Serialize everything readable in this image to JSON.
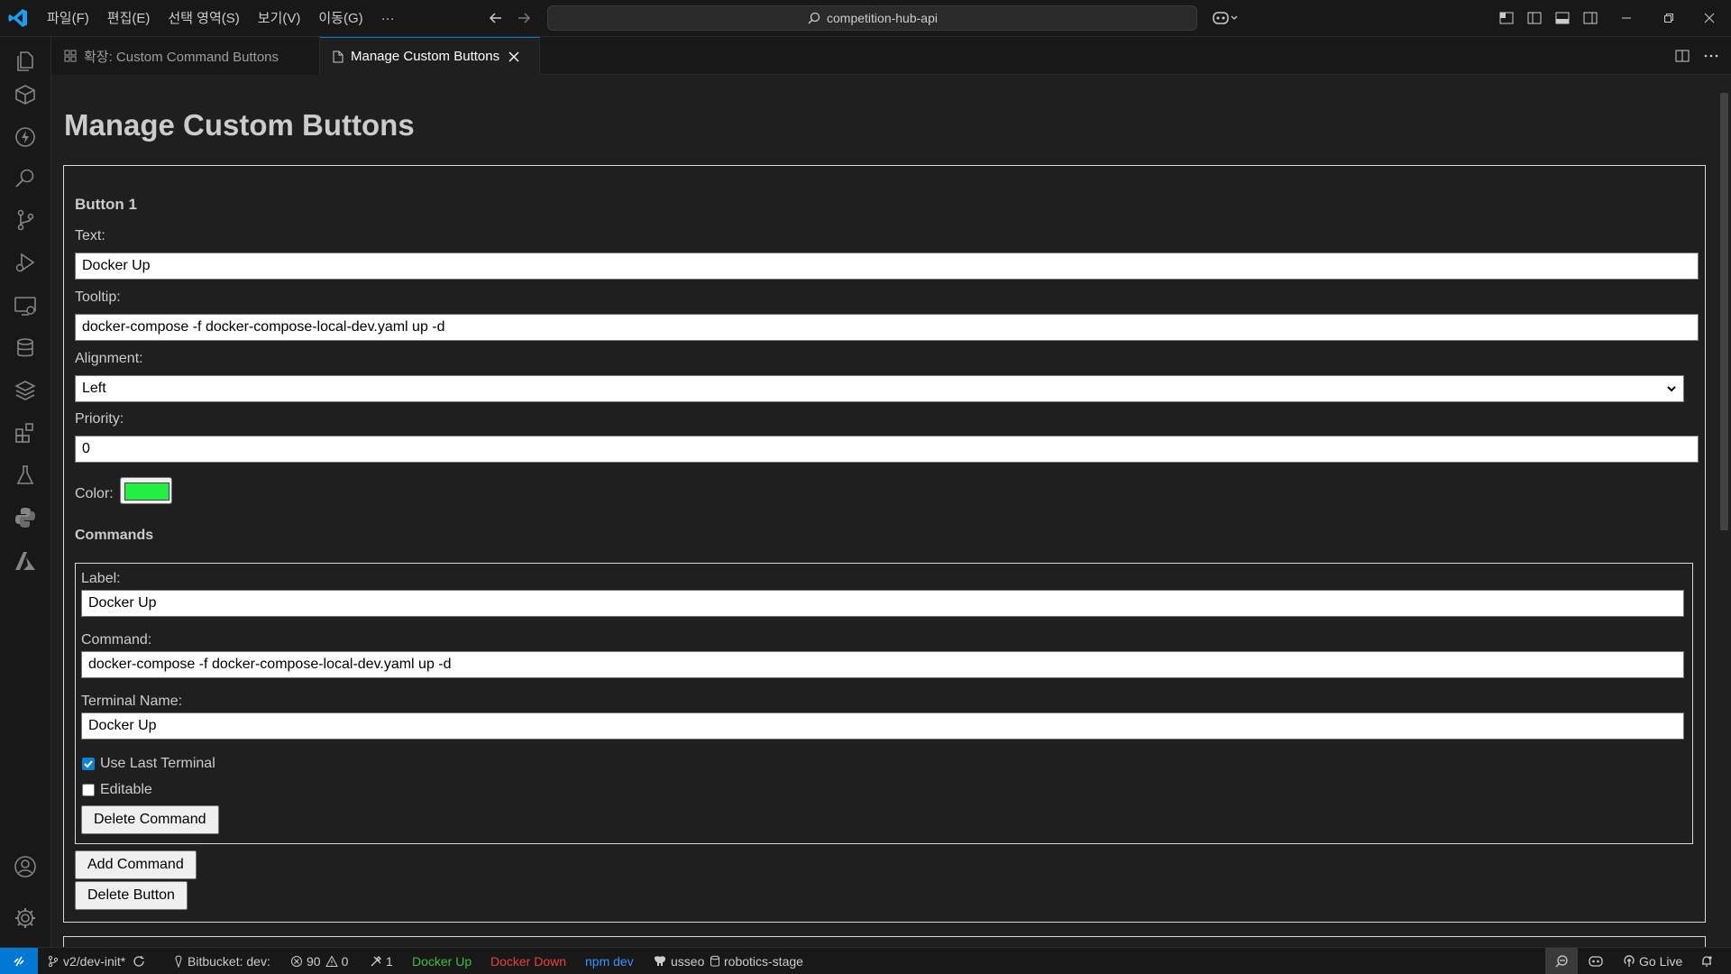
{
  "titlebar": {
    "menus": [
      "파일(F)",
      "편집(E)",
      "선택 영역(S)",
      "보기(V)",
      "이동(G)",
      "···"
    ],
    "search_text": "competition-hub-api"
  },
  "tabs": [
    {
      "label": "확장: Custom Command Buttons",
      "active": false,
      "icon": "extensions-icon"
    },
    {
      "label": "Manage Custom Buttons",
      "active": true,
      "icon": "file-icon"
    }
  ],
  "page": {
    "title": "Manage Custom Buttons",
    "button": {
      "heading": "Button 1",
      "text_label": "Text:",
      "text_value": "Docker Up",
      "tooltip_label": "Tooltip:",
      "tooltip_value": "docker-compose -f docker-compose-local-dev.yaml up -d",
      "alignment_label": "Alignment:",
      "alignment_value": "Left",
      "priority_label": "Priority:",
      "priority_value": "0",
      "color_label": "Color:",
      "color_value": "#22ee44",
      "commands_heading": "Commands",
      "command": {
        "label_label": "Label:",
        "label_value": "Docker Up",
        "command_label": "Command:",
        "command_value": "docker-compose -f docker-compose-local-dev.yaml up -d",
        "terminal_label": "Terminal Name:",
        "terminal_value": "Docker Up",
        "use_last_terminal_label": "Use Last Terminal",
        "use_last_terminal_checked": true,
        "editable_label": "Editable",
        "editable_checked": false,
        "delete_command_label": "Delete Command"
      },
      "add_command_label": "Add Command",
      "delete_button_label": "Delete Button"
    }
  },
  "statusbar": {
    "branch": "v2/dev-init*",
    "bitbucket": "Bitbucket: dev:",
    "errors": "90",
    "warnings": "0",
    "ports": "1",
    "docker_up": "Docker Up",
    "docker_down": "Docker Down",
    "npm_dev": "npm dev",
    "user": "usseo",
    "db": "robotics-stage",
    "go_live": "Go Live",
    "colors": {
      "docker_up": "#3fbf3f",
      "docker_down": "#e8413b",
      "npm_dev": "#3794ff",
      "accent": "#0078d4"
    }
  }
}
